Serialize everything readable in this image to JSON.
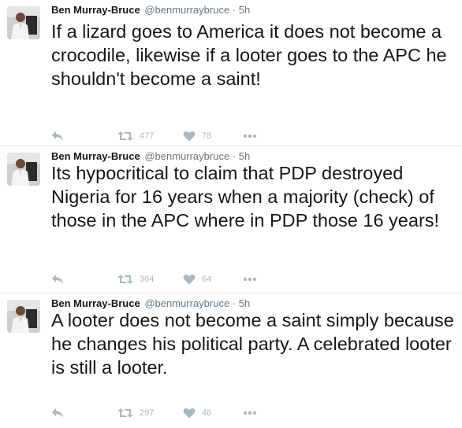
{
  "colors": {
    "text": "#14171a",
    "secondary": "#657786",
    "action_icon": "#aab8c2",
    "divider": "#e1e8ed"
  },
  "tweets": [
    {
      "author": {
        "name": "Ben Murray-Bruce",
        "handle": "@benmurraybruce"
      },
      "separator": "·",
      "time": "5h",
      "text": "If a lizard goes to America it does not become a crocodile, likewise if a looter goes to the APC he shouldn't become a saint!",
      "retweets": "477",
      "likes": "78",
      "icons": [
        "reply-icon",
        "retweet-icon",
        "heart-icon",
        "more-icon"
      ]
    },
    {
      "author": {
        "name": "Ben Murray-Bruce",
        "handle": "@benmurraybruce"
      },
      "separator": "·",
      "time": "5h",
      "text": "Its hypocritical to claim that PDP destroyed Nigeria for 16 years when a majority (check) of those in the APC where in PDP those 16 years!",
      "retweets": "364",
      "likes": "64",
      "icons": [
        "reply-icon",
        "retweet-icon",
        "heart-icon",
        "more-icon"
      ]
    },
    {
      "author": {
        "name": "Ben Murray-Bruce",
        "handle": "@benmurraybruce"
      },
      "separator": "·",
      "time": "5h",
      "text": "A looter does not become a saint simply because he changes his political party. A celebrated looter is still a looter.",
      "retweets": "297",
      "likes": "46",
      "icons": [
        "reply-icon",
        "retweet-icon",
        "heart-icon",
        "more-icon"
      ]
    }
  ]
}
